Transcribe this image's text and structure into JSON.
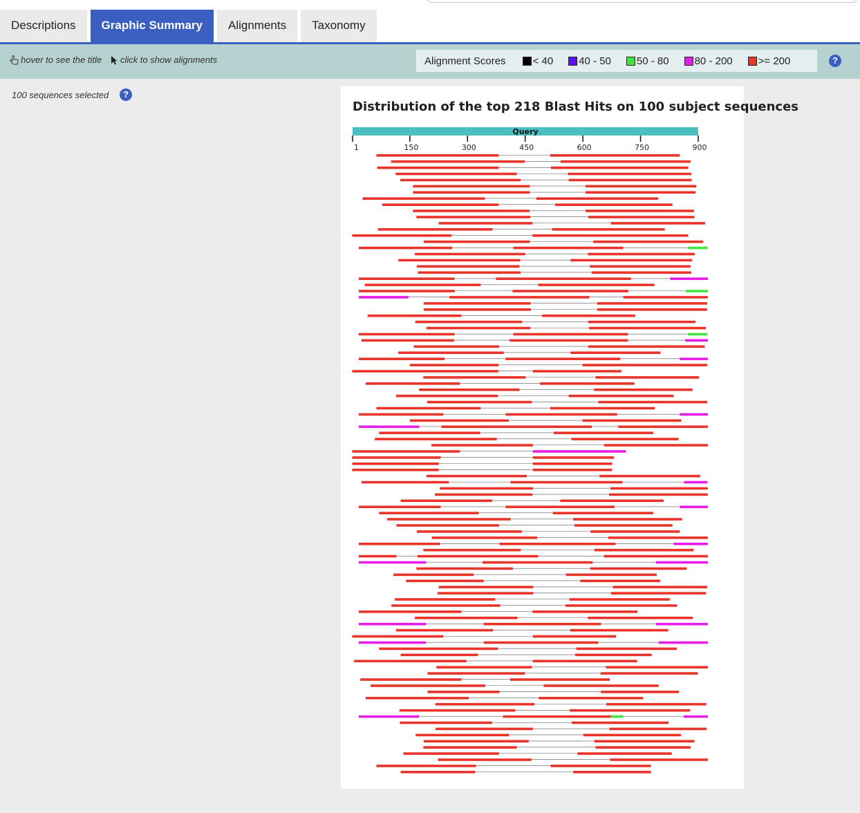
{
  "tabs": [
    {
      "label": "Descriptions",
      "active": false
    },
    {
      "label": "Graphic Summary",
      "active": true
    },
    {
      "label": "Alignments",
      "active": false
    },
    {
      "label": "Taxonomy",
      "active": false
    }
  ],
  "toolbar": {
    "hover_hint": "hover to see the title",
    "click_hint": "click to show alignments",
    "hover_icon": "hand-pointer-icon",
    "click_icon": "arrow-cursor-icon"
  },
  "legend": {
    "label": "Alignment Scores",
    "items": [
      {
        "label": "< 40",
        "color": "#000000"
      },
      {
        "label": "40 - 50",
        "color": "#5a10f0"
      },
      {
        "label": "50 - 80",
        "color": "#3ee63e"
      },
      {
        "label": "80 - 200",
        "color": "#e81be8"
      },
      {
        "label": ">= 200",
        "color": "#e8342a"
      }
    ],
    "help_icon": "?"
  },
  "selection": {
    "text": "100 sequences selected",
    "help_icon": "?"
  },
  "graphic": {
    "title": "Distribution of the top 218 Blast Hits on 100 subject sequences",
    "query_label": "Query",
    "query_color": "#4bbfbf",
    "query_length": 900,
    "ticks": [
      1,
      150,
      300,
      450,
      600,
      750,
      900
    ],
    "colors": {
      "red": "#e8342a",
      "magenta": "#e81be8",
      "green": "#3ee63e",
      "black": "#000000",
      "line": "#555555"
    },
    "hits": [
      [
        [
          63,
          381,
          "r"
        ],
        [
          515,
          852,
          "r"
        ]
      ],
      [
        [
          101,
          449,
          "r"
        ],
        [
          542,
          880,
          "r"
        ]
      ],
      [
        [
          65,
          381,
          "r"
        ],
        [
          517,
          874,
          "r"
        ]
      ],
      [
        [
          113,
          428,
          "r"
        ],
        [
          561,
          882,
          "r"
        ]
      ],
      [
        [
          125,
          438,
          "r"
        ],
        [
          563,
          883,
          "r"
        ]
      ],
      [
        [
          158,
          462,
          "r"
        ],
        [
          607,
          895,
          "r"
        ]
      ],
      [
        [
          158,
          462,
          "r"
        ],
        [
          607,
          893,
          "r"
        ]
      ],
      [
        [
          27,
          345,
          "r"
        ],
        [
          479,
          796,
          "r"
        ]
      ],
      [
        [
          78,
          381,
          "r"
        ],
        [
          528,
          833,
          "r"
        ]
      ],
      [
        [
          158,
          461,
          "r"
        ],
        [
          607,
          889,
          "r"
        ]
      ],
      [
        [
          167,
          463,
          "r"
        ],
        [
          614,
          890,
          "r"
        ]
      ],
      [
        [
          225,
          469,
          "r"
        ],
        [
          673,
          918,
          "r"
        ]
      ],
      [
        [
          67,
          365,
          "r"
        ],
        [
          520,
          813,
          "r"
        ]
      ],
      [
        [
          0,
          258,
          "r"
        ],
        [
          469,
          874,
          "r"
        ]
      ],
      [
        [
          186,
          462,
          "r"
        ],
        [
          627,
          913,
          "r"
        ]
      ],
      [
        [
          17,
          260,
          "r"
        ],
        [
          419,
          705,
          "r"
        ],
        [
          873,
          924,
          "g"
        ]
      ],
      [
        [
          163,
          450,
          "r"
        ],
        [
          613,
          891,
          "r"
        ]
      ],
      [
        [
          120,
          437,
          "r"
        ],
        [
          568,
          884,
          "r"
        ]
      ],
      [
        [
          168,
          435,
          "r"
        ],
        [
          618,
          880,
          "r"
        ]
      ],
      [
        [
          171,
          438,
          "r"
        ],
        [
          623,
          882,
          "r"
        ]
      ],
      [
        [
          17,
          266,
          "r"
        ],
        [
          374,
          725,
          "r"
        ],
        [
          827,
          925,
          "m"
        ]
      ],
      [
        [
          33,
          334,
          "r"
        ],
        [
          484,
          786,
          "r"
        ]
      ],
      [
        [
          17,
          267,
          "r"
        ],
        [
          417,
          718,
          "r"
        ],
        [
          868,
          925,
          "g"
        ]
      ],
      [
        [
          17,
          146,
          "m"
        ],
        [
          253,
          617,
          "r"
        ],
        [
          705,
          925,
          "r"
        ]
      ],
      [
        [
          186,
          464,
          "r"
        ],
        [
          637,
          923,
          "r"
        ]
      ],
      [
        [
          186,
          465,
          "r"
        ],
        [
          637,
          923,
          "r"
        ]
      ],
      [
        [
          40,
          284,
          "r"
        ],
        [
          494,
          736,
          "r"
        ]
      ],
      [
        [
          164,
          442,
          "r"
        ],
        [
          614,
          893,
          "r"
        ]
      ],
      [
        [
          193,
          463,
          "r"
        ],
        [
          616,
          920,
          "r"
        ]
      ],
      [
        [
          17,
          266,
          "r"
        ],
        [
          419,
          717,
          "r"
        ],
        [
          873,
          924,
          "g"
        ]
      ],
      [
        [
          24,
          265,
          "r"
        ],
        [
          409,
          717,
          "r"
        ],
        [
          866,
          925,
          "m"
        ]
      ],
      [
        [
          160,
          382,
          "r"
        ],
        [
          614,
          917,
          "r"
        ]
      ],
      [
        [
          120,
          394,
          "r"
        ],
        [
          568,
          802,
          "r"
        ]
      ],
      [
        [
          17,
          240,
          "r"
        ],
        [
          399,
          697,
          "r"
        ],
        [
          852,
          925,
          "m"
        ]
      ],
      [
        [
          150,
          381,
          "r"
        ],
        [
          599,
          923,
          "r"
        ]
      ],
      [
        [
          0,
          380,
          "r"
        ],
        [
          470,
          700,
          "r"
        ]
      ],
      [
        [
          185,
          451,
          "r"
        ],
        [
          633,
          902,
          "r"
        ]
      ],
      [
        [
          35,
          280,
          "r"
        ],
        [
          488,
          734,
          "r"
        ]
      ],
      [
        [
          174,
          435,
          "r"
        ],
        [
          629,
          885,
          "r"
        ]
      ],
      [
        [
          114,
          379,
          "r"
        ],
        [
          563,
          836,
          "r"
        ]
      ],
      [
        [
          195,
          467,
          "r"
        ],
        [
          640,
          923,
          "r"
        ]
      ],
      [
        [
          63,
          334,
          "r"
        ],
        [
          515,
          787,
          "r"
        ]
      ],
      [
        [
          17,
          237,
          "r"
        ],
        [
          399,
          689,
          "r"
        ],
        [
          852,
          925,
          "m"
        ]
      ],
      [
        [
          150,
          407,
          "r"
        ],
        [
          599,
          856,
          "r"
        ]
      ],
      [
        [
          17,
          174,
          "m"
        ],
        [
          232,
          623,
          "r"
        ],
        [
          692,
          925,
          "r"
        ]
      ],
      [
        [
          70,
          333,
          "r"
        ],
        [
          524,
          783,
          "r"
        ]
      ],
      [
        [
          59,
          376,
          "r"
        ],
        [
          570,
          849,
          "r"
        ]
      ],
      [
        [
          206,
          470,
          "r"
        ],
        [
          655,
          925,
          "r"
        ]
      ],
      [
        [
          0,
          280,
          "r"
        ],
        [
          470,
          680,
          "m"
        ],
        [
          680,
          712,
          "m"
        ]
      ],
      [
        [
          0,
          230,
          "r"
        ],
        [
          470,
          681,
          "r"
        ]
      ],
      [
        [
          0,
          225,
          "r"
        ],
        [
          470,
          676,
          "r"
        ]
      ],
      [
        [
          0,
          225,
          "r"
        ],
        [
          470,
          676,
          "r"
        ]
      ],
      [
        [
          193,
          454,
          "r"
        ],
        [
          643,
          905,
          "r"
        ]
      ],
      [
        [
          24,
          251,
          "r"
        ],
        [
          412,
          703,
          "r"
        ],
        [
          863,
          924,
          "m"
        ]
      ],
      [
        [
          228,
          470,
          "r"
        ],
        [
          672,
          925,
          "r"
        ]
      ],
      [
        [
          215,
          469,
          "r"
        ],
        [
          668,
          925,
          "r"
        ]
      ],
      [
        [
          126,
          364,
          "r"
        ],
        [
          541,
          810,
          "r"
        ]
      ],
      [
        [
          17,
          230,
          "r"
        ],
        [
          399,
          682,
          "r"
        ],
        [
          852,
          925,
          "m"
        ]
      ],
      [
        [
          70,
          329,
          "r"
        ],
        [
          522,
          783,
          "r"
        ]
      ],
      [
        [
          91,
          412,
          "r"
        ],
        [
          575,
          858,
          "r"
        ]
      ],
      [
        [
          115,
          382,
          "r"
        ],
        [
          578,
          833,
          "r"
        ]
      ],
      [
        [
          168,
          441,
          "r"
        ],
        [
          620,
          852,
          "r"
        ]
      ],
      [
        [
          207,
          481,
          "r"
        ],
        [
          666,
          925,
          "r"
        ]
      ],
      [
        [
          17,
          228,
          "r"
        ],
        [
          383,
          685,
          "r"
        ],
        [
          836,
          925,
          "m"
        ]
      ],
      [
        [
          185,
          438,
          "r"
        ],
        [
          630,
          888,
          "r"
        ]
      ],
      [
        [
          17,
          115,
          "r"
        ],
        [
          170,
          484,
          "r"
        ],
        [
          655,
          925,
          "r"
        ]
      ],
      [
        [
          17,
          192,
          "m"
        ],
        [
          339,
          625,
          "r"
        ],
        [
          790,
          925,
          "m"
        ]
      ],
      [
        [
          167,
          418,
          "r"
        ],
        [
          619,
          870,
          "r"
        ]
      ],
      [
        [
          107,
          316,
          "r"
        ],
        [
          556,
          792,
          "r"
        ]
      ],
      [
        [
          140,
          342,
          "r"
        ],
        [
          593,
          801,
          "r"
        ]
      ],
      [
        [
          225,
          471,
          "r"
        ],
        [
          678,
          923,
          "r"
        ]
      ],
      [
        [
          222,
          471,
          "r"
        ],
        [
          673,
          920,
          "r"
        ]
      ],
      [
        [
          111,
          372,
          "r"
        ],
        [
          565,
          826,
          "r"
        ]
      ],
      [
        [
          102,
          385,
          "r"
        ],
        [
          555,
          845,
          "r"
        ]
      ],
      [
        [
          17,
          284,
          "r"
        ],
        [
          469,
          742,
          "r"
        ]
      ],
      [
        [
          163,
          430,
          "r"
        ],
        [
          613,
          886,
          "r"
        ]
      ],
      [
        [
          17,
          192,
          "m"
        ],
        [
          342,
          647,
          "r"
        ],
        [
          790,
          925,
          "m"
        ]
      ],
      [
        [
          114,
          366,
          "r"
        ],
        [
          567,
          822,
          "r"
        ]
      ],
      [
        [
          0,
          237,
          "r"
        ],
        [
          470,
          686,
          "r"
        ]
      ],
      [
        [
          17,
          192,
          "m"
        ],
        [
          342,
          640,
          "r"
        ],
        [
          797,
          925,
          "m"
        ]
      ],
      [
        [
          70,
          379,
          "r"
        ],
        [
          583,
          844,
          "r"
        ]
      ],
      [
        [
          126,
          327,
          "r"
        ],
        [
          580,
          779,
          "r"
        ]
      ],
      [
        [
          5,
          297,
          "r"
        ],
        [
          470,
          741,
          "r"
        ]
      ],
      [
        [
          219,
          467,
          "r"
        ],
        [
          660,
          925,
          "r"
        ]
      ],
      [
        [
          196,
          449,
          "r"
        ],
        [
          646,
          899,
          "r"
        ]
      ],
      [
        [
          21,
          284,
          "r"
        ],
        [
          411,
          670,
          "r"
        ]
      ],
      [
        [
          48,
          346,
          "r"
        ],
        [
          498,
          797,
          "r"
        ]
      ],
      [
        [
          196,
          383,
          "r"
        ],
        [
          647,
          850,
          "r"
        ]
      ],
      [
        [
          35,
          303,
          "r"
        ],
        [
          485,
          757,
          "r"
        ]
      ],
      [
        [
          216,
          474,
          "r"
        ],
        [
          661,
          921,
          "r"
        ]
      ],
      [
        [
          123,
          424,
          "r"
        ],
        [
          566,
          879,
          "r"
        ]
      ],
      [
        [
          17,
          174,
          "m"
        ],
        [
          392,
          673,
          "r"
        ],
        [
          673,
          705,
          "g"
        ],
        [
          862,
          925,
          "m"
        ]
      ],
      [
        [
          124,
          364,
          "r"
        ],
        [
          571,
          823,
          "r"
        ]
      ],
      [
        [
          217,
          470,
          "r"
        ],
        [
          669,
          922,
          "r"
        ]
      ],
      [
        [
          165,
          408,
          "r"
        ],
        [
          601,
          855,
          "r"
        ]
      ],
      [
        [
          186,
          459,
          "r"
        ],
        [
          630,
          890,
          "r"
        ]
      ],
      [
        [
          185,
          428,
          "r"
        ],
        [
          633,
          880,
          "r"
        ]
      ],
      [
        [
          133,
          382,
          "r"
        ],
        [
          586,
          831,
          "r"
        ]
      ],
      [
        [
          223,
          466,
          "r"
        ],
        [
          671,
          925,
          "r"
        ]
      ],
      [
        [
          63,
          322,
          "r"
        ],
        [
          516,
          777,
          "r"
        ]
      ],
      [
        [
          126,
          320,
          "r"
        ],
        [
          575,
          777,
          "r"
        ]
      ]
    ]
  }
}
